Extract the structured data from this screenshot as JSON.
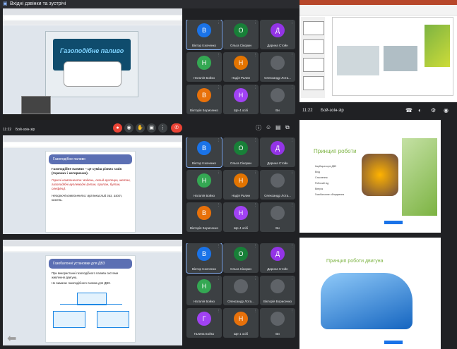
{
  "window_title": "Вхідні дзвінки та зустрічі",
  "q1": {
    "slide_title": "Газоподібне паливо"
  },
  "q2": {
    "slide_header": "Газоподібне паливо",
    "bullets": [
      "Газоподібне паливо – це суміш різних газів (горючих і негорючих).",
      "Горючі компоненти: водень, оксид вуглецю, метан, газоподібні вуглеводні (етан, пропан, бутан, олефіни).",
      "Негорючі компоненти: вуглекислий газ, азот, кисень."
    ],
    "time": "11:22",
    "meeting": "Бой-зоін-зір"
  },
  "q3": {
    "slide_header": "Газобалонні установки для ДВЗ",
    "bullets": [
      "При використанні газоподібного палива системи живлення двигуна.",
      "Не вимагає газоподібного палива для ДВЗ."
    ]
  },
  "participants": [
    {
      "name": "Віктор Іскоченко",
      "initial": "В",
      "color": "#1a73e8"
    },
    {
      "name": "Ольга Сікорин",
      "initial": "О",
      "color": "#188038"
    },
    {
      "name": "Дарина Стойн",
      "initial": "Д",
      "color": "#9334e6"
    },
    {
      "name": "Наталія Бойко",
      "initial": "Н",
      "color": "#34a853"
    },
    {
      "name": "Надія Ралин",
      "initial": "Н",
      "color": "#e37400"
    },
    {
      "name": "Олександр Лота...",
      "initial": "",
      "color": "#5f6368"
    },
    {
      "name": "Вікторія Борисенко",
      "initial": "В",
      "color": "#e8710a"
    },
    {
      "name": "Ще 4 осіб",
      "initial": "Н",
      "color": "#a142f4"
    },
    {
      "name": "Ви",
      "initial": "",
      "color": "#5f6368"
    }
  ],
  "participants3": [
    {
      "name": "Віктор Іскоченко",
      "initial": "В",
      "color": "#1a73e8"
    },
    {
      "name": "Ольга Сікорин",
      "initial": "О",
      "color": "#188038"
    },
    {
      "name": "Дарина Стойн",
      "initial": "Д",
      "color": "#9334e6"
    },
    {
      "name": "Наталія Бойко",
      "initial": "Н",
      "color": "#34a853"
    },
    {
      "name": "Олександр Лота...",
      "initial": "",
      "color": "#5f6368"
    },
    {
      "name": "Вікторія Борисенко",
      "initial": "",
      "color": "#5f6368"
    },
    {
      "name": "Галина Бойко",
      "initial": "Г",
      "color": "#a142f4"
    },
    {
      "name": "Ще 1 осіб",
      "initial": "Н",
      "color": "#e8710a"
    },
    {
      "name": "Ви",
      "initial": "",
      "color": "#5f6368"
    }
  ],
  "right_top": {
    "time": "11:22",
    "meeting": "Бой-зоін-зір"
  },
  "right_slide1": {
    "title": "Принцип роботи",
    "bullets": [
      "Карбюраторні ДВЗ",
      "Вхід",
      "Стиснення",
      "Робочий хід",
      "Випуск",
      "Газобалонне обладнання"
    ]
  },
  "right_slide2": {
    "title": "Принцип роботи двигуна"
  },
  "colors": {
    "green_accent": "#7cb342",
    "dark_bg": "#202124",
    "tile_bg": "#3c4043",
    "red": "#ea4335"
  }
}
